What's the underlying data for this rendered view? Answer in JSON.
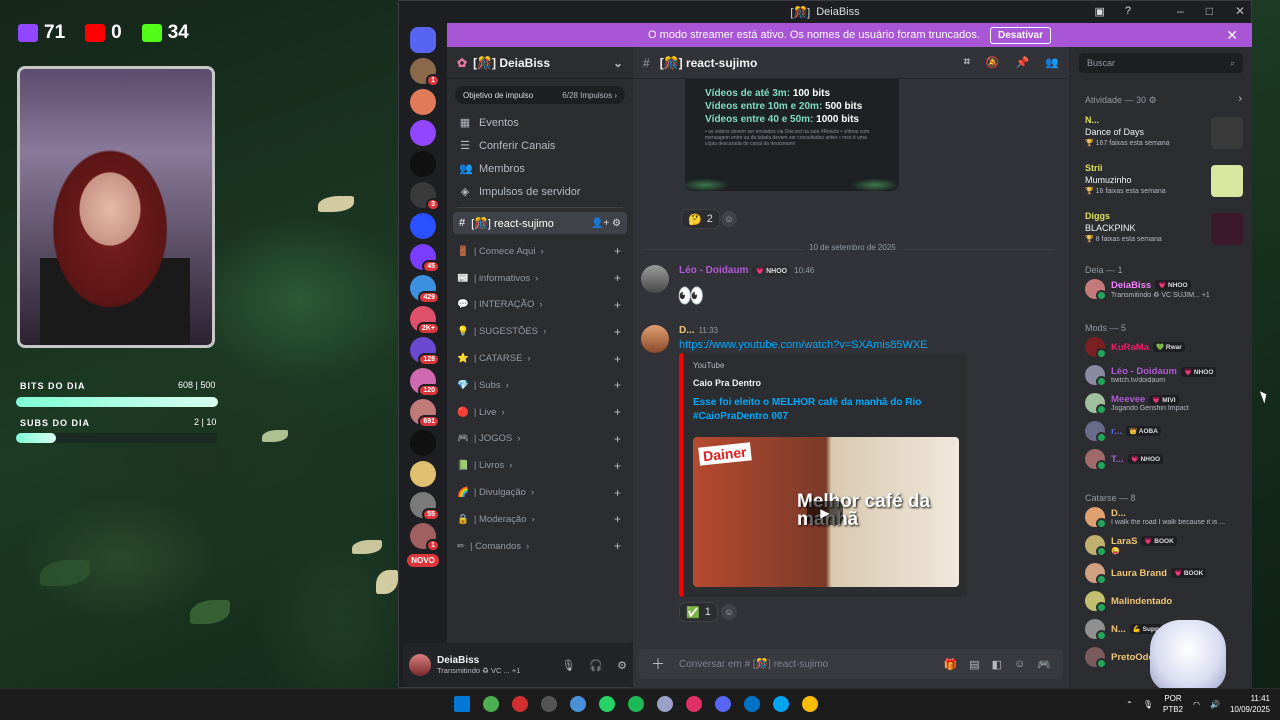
{
  "overlay": {
    "twitch_count": "71",
    "youtube_count": "0",
    "kick_count": "34",
    "bits_label": "BITS DO DIA",
    "bits_value": "608 | 500",
    "bits_progress": 1.0,
    "subs_label": "SUBS DO DIA",
    "subs_value": "2 | 10",
    "subs_progress": 0.2
  },
  "window": {
    "title": "DeiaBiss",
    "title_prefix": "[🎊]"
  },
  "banner": {
    "text": "O modo streamer está ativo. Os nomes de usuário foram truncados.",
    "button": "Desativar"
  },
  "guild_badges": [
    "1",
    "",
    "",
    "",
    "3",
    "",
    "45",
    "429",
    "2K+",
    "128",
    "120",
    "691",
    "",
    "",
    "55",
    "1"
  ],
  "guild_new": "NOVO",
  "server": {
    "name": "[🎊] DeiaBiss",
    "boost_goal": "Objetivo de impulso",
    "boost_count": "6/28 Impulsos",
    "nav": [
      "Eventos",
      "Conferir Canais",
      "Membros",
      "Impulsos de servidor"
    ],
    "current_channel": "[🎊] react-sujimo",
    "categories": [
      "| Comece Aqui",
      "| informativos",
      "| INTERAÇÃO",
      "| SUGESTÕES",
      "| CATARSE",
      "| Subs",
      "| Live",
      "| JOGOS",
      "| Livros",
      "| Divulgação",
      "| Moderação",
      "| Comandos"
    ]
  },
  "user_panel": {
    "name": "DeiaBiss",
    "status": "Transmitindo ♻ VC ...",
    "extra": "+1"
  },
  "chat": {
    "channel": "[🎊] react-sujimo",
    "embed_lines": [
      {
        "label": "Vídeos de até 3m:",
        "value": "100 bits"
      },
      {
        "label": "Vídeos entre 10m e 20m:",
        "value": "500 bits"
      },
      {
        "label": "Vídeos entre 40 e 50m:",
        "value": "1000 bits"
      }
    ],
    "embed_fine_print": "• os vídeos devem ser enviados via Discord na sala #Reacts • vídeos com mensagem entre as da tabela devem ser consultadas antes • mso é uma cópia descarada do canal da rkrutzmann",
    "reaction1_count": "2",
    "date_divider": "10 de setembro de 2025",
    "msg1": {
      "author": "Léo - Doidaum",
      "tag": "💗 NHOO",
      "time": "10:46",
      "content": "👀"
    },
    "msg2": {
      "author": "D...",
      "time": "11:33",
      "link": "https://www.youtube.com/watch?v=SXAmis85WXE",
      "provider": "YouTube",
      "embed_author": "Caio Pra Dentro",
      "embed_title": "Esse foi eleito o MELHOR café da manhã do Rio #CaioPraDentro 007",
      "thumb_brand": "Dainer",
      "thumb_caption": "Melhor café da manhã"
    },
    "reaction2_count": "1",
    "composer_placeholder": "Conversar em # [🎊] react-sujimo"
  },
  "members": {
    "search_placeholder": "Buscar",
    "activity_header": "Atividade — 30",
    "activity": [
      {
        "name": "N...",
        "title": "Dance of Days",
        "stat": "🏆 167 faixas esta semana"
      },
      {
        "name": "Strii",
        "title": "Mumuzinho",
        "stat": "🏆 16 faixas esta semana"
      },
      {
        "name": "Diggs",
        "title": "BLACKPINK",
        "stat": "🏆 8 faixas esta semana"
      }
    ],
    "deia_header": "Deia — 1",
    "deia": [
      {
        "name": "DeiaBiss",
        "badge": "💗 NHOO",
        "status": "Transmitindo ♻ VC SUJIM...",
        "extra": "+1"
      }
    ],
    "mods_header": "Mods — 5",
    "mods": [
      {
        "name": "KuRaMa",
        "badge": "💚 Rwar",
        "status": ""
      },
      {
        "name": "Léo - Doidaum",
        "badge": "💗 NHOO",
        "status": "twitch.tv/doidaum"
      },
      {
        "name": "Meevee",
        "badge": "💗 MIVI",
        "status": "Jogando Genshin Impact"
      },
      {
        "name": "r...",
        "badge": "👑 AOBA",
        "status": ""
      },
      {
        "name": "T...",
        "badge": "💗 NHOO",
        "status": ""
      }
    ],
    "catarse_header": "Catarse — 8",
    "catarse": [
      {
        "name": "D...",
        "badge": "",
        "status": "I walk the road I walk because it is ..."
      },
      {
        "name": "LaraS",
        "badge": "💗 BOOK",
        "status": "😜"
      },
      {
        "name": "Laura Brand",
        "badge": "💗 BOOK",
        "status": ""
      },
      {
        "name": "Malindentado",
        "badge": "",
        "status": ""
      },
      {
        "name": "N...",
        "badge": "💪 Supp",
        "status": ""
      },
      {
        "name": "PretoOdom",
        "badge": "",
        "status": ""
      }
    ]
  },
  "taskbar": {
    "lang": "POR",
    "layout": "PTB2",
    "time": "11:41",
    "date": "10/09/2025"
  },
  "colors": {
    "accent": "#a855d6",
    "online": "#23a55a",
    "link": "#00a8fc",
    "bar": "#7fffd4"
  }
}
